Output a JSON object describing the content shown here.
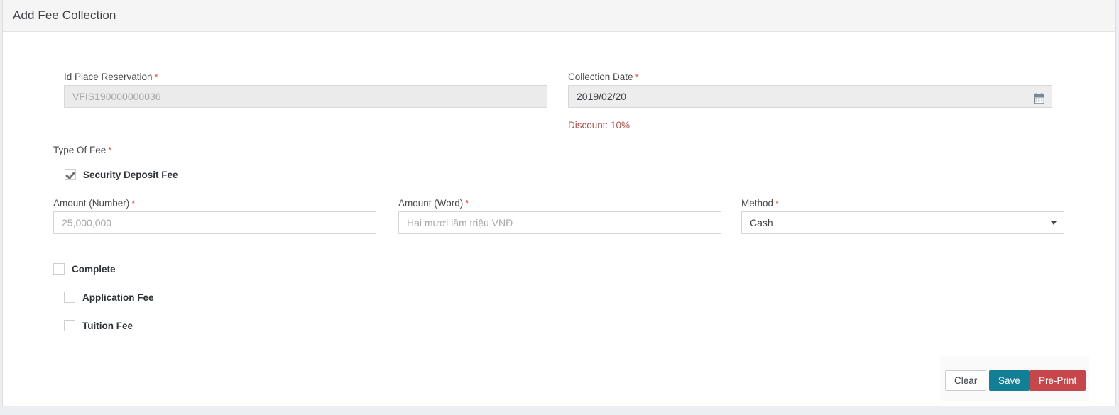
{
  "header": {
    "title": "Add Fee Collection"
  },
  "form": {
    "id_place_reservation": {
      "label": "Id Place Reservation",
      "required_mark": "*",
      "value": "",
      "placeholder": "VFIS190000000036",
      "disabled": true
    },
    "collection_date": {
      "label": "Collection Date",
      "required_mark": "*",
      "value": "2019/02/20",
      "placeholder": "",
      "calendar_icon": "calendar-icon"
    },
    "discount_note": "Discount: 10%",
    "type_of_fee": {
      "label": "Type Of Fee",
      "required_mark": "*",
      "options": [
        {
          "label": "Security Deposit Fee",
          "checked": true
        }
      ]
    },
    "amount_number": {
      "label": "Amount (Number)",
      "required_mark": "*",
      "value": "",
      "placeholder": "25,000,000"
    },
    "amount_word": {
      "label": "Amount (Word)",
      "required_mark": "*",
      "value": "",
      "placeholder": "Hai mươi lăm triệu VNĐ"
    },
    "method": {
      "label": "Method",
      "required_mark": "*",
      "selected": "Cash",
      "options": [
        "Cash"
      ]
    },
    "status_checkboxes": [
      {
        "label": "Complete",
        "checked": false
      },
      {
        "label": "Application Fee",
        "checked": false
      },
      {
        "label": "Tuition Fee",
        "checked": false
      }
    ]
  },
  "footer": {
    "clear_label": "Clear",
    "save_label": "Save",
    "preprint_label": "Pre-Print"
  },
  "colors": {
    "required_red": "#e2483c",
    "discount_red": "#a9544e",
    "save_teal": "#137f96",
    "preprint_red": "#c5474b",
    "header_bg": "#f5f5f5",
    "page_bg": "#eceef1"
  }
}
